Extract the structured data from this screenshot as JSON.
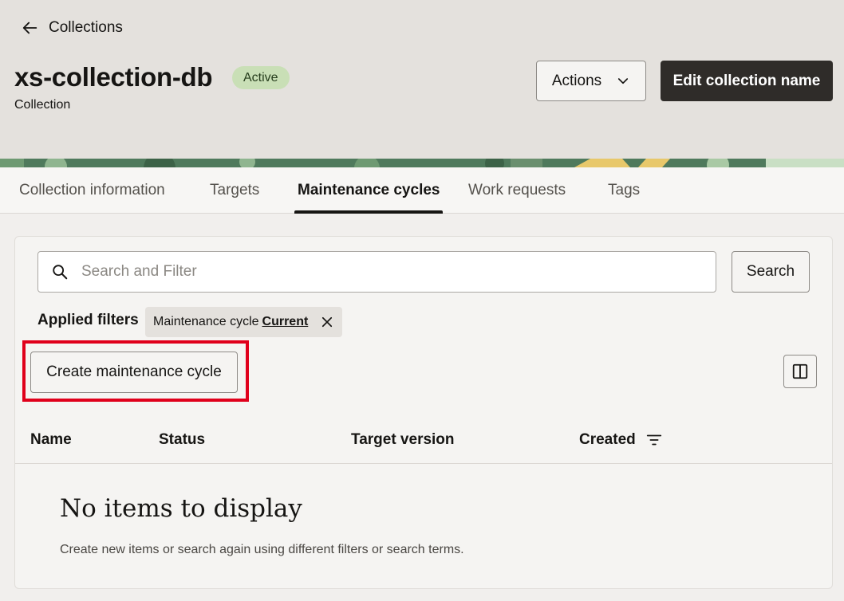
{
  "header": {
    "back_label": "Collections",
    "title": "xs-collection-db",
    "status_badge": "Active",
    "subtitle": "Collection",
    "actions_label": "Actions",
    "edit_label": "Edit collection name"
  },
  "tabs": [
    {
      "label": "Collection information",
      "active": false
    },
    {
      "label": "Targets",
      "active": false
    },
    {
      "label": "Maintenance cycles",
      "active": true
    },
    {
      "label": "Work requests",
      "active": false
    },
    {
      "label": "Tags",
      "active": false
    }
  ],
  "search": {
    "placeholder": "Search and Filter",
    "button_label": "Search"
  },
  "filters": {
    "label": "Applied filters",
    "chip_name": "Maintenance cycle",
    "chip_value": "Current"
  },
  "toolbar": {
    "create_label": "Create maintenance cycle"
  },
  "table": {
    "columns": [
      "Name",
      "Status",
      "Target version",
      "Created"
    ]
  },
  "empty_state": {
    "title": "No items to display",
    "description": "Create new items or search again using different filters or search terms."
  },
  "colors": {
    "primary_button": "#2f2c29",
    "badge_bg": "#c9dfb6",
    "highlight": "#e0001b"
  },
  "icons": [
    "arrow-left-icon",
    "chevron-down-icon",
    "search-icon",
    "close-icon",
    "columns-icon",
    "filter-icon"
  ]
}
